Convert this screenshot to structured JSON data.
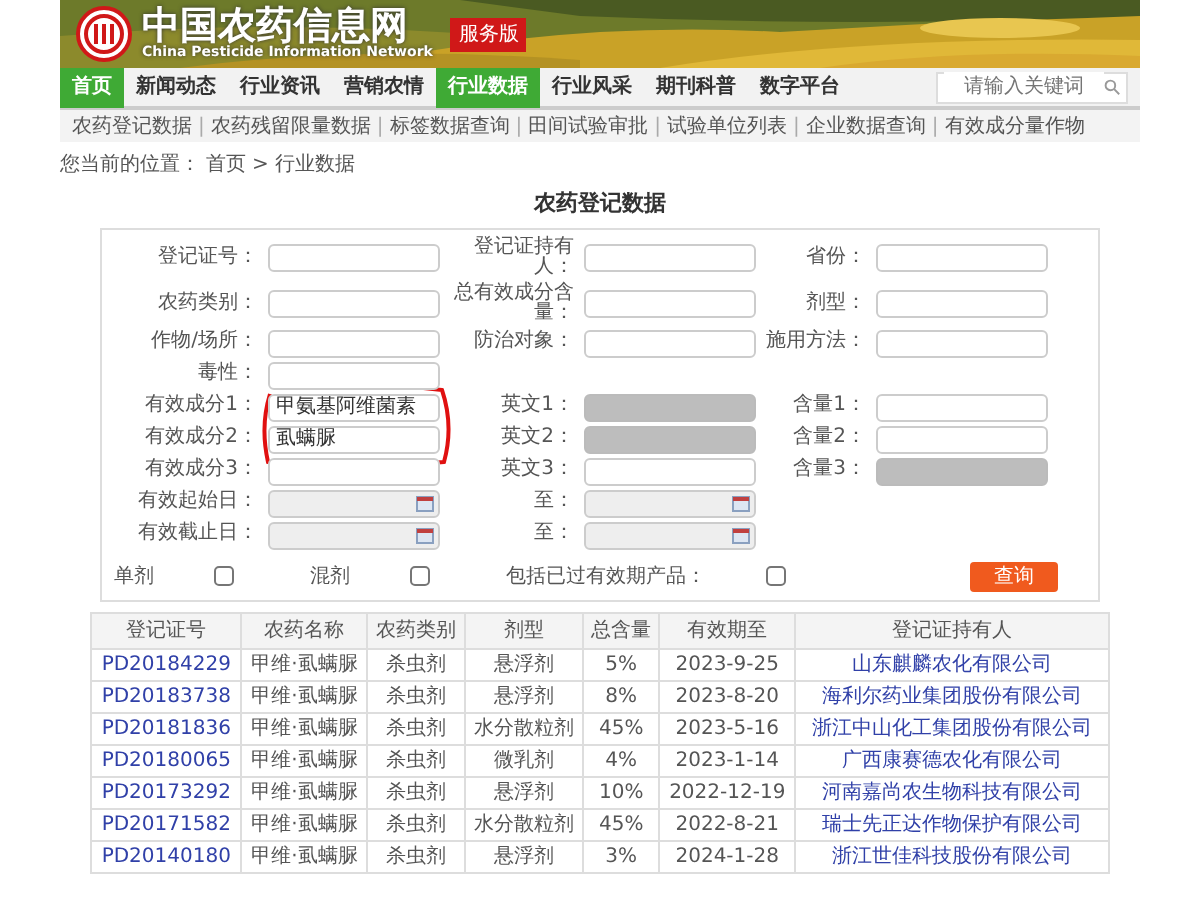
{
  "banner": {
    "title": "中国农药信息网",
    "subtitle": "China Pesticide Information Network",
    "badge": "服务版"
  },
  "nav": {
    "items": [
      {
        "label": "首页",
        "selected": true
      },
      {
        "label": "新闻动态",
        "selected": false
      },
      {
        "label": "行业资讯",
        "selected": false
      },
      {
        "label": "营销农情",
        "selected": false
      },
      {
        "label": "行业数据",
        "selected": true
      },
      {
        "label": "行业风采",
        "selected": false
      },
      {
        "label": "期刊科普",
        "selected": false
      },
      {
        "label": "数字平台",
        "selected": false
      }
    ],
    "search": {
      "placeholder": "请输入关键词"
    }
  },
  "subnav": {
    "items": [
      "农药登记数据",
      "农药残留限量数据",
      "标签数据查询",
      "田间试验审批",
      "试验单位列表",
      "企业数据查询",
      "有效成分量作物"
    ],
    "separator": "|"
  },
  "breadcrumb": {
    "prefix": "您当前的位置：",
    "items": [
      "首页",
      "行业数据"
    ],
    "separator": ">"
  },
  "page_title": "农药登记数据",
  "form": {
    "rows": [
      [
        {
          "label": "登记证号：",
          "kind": "text",
          "disabled": false
        },
        {
          "label": "登记证持有人：",
          "kind": "text",
          "disabled": false
        },
        {
          "label": "省份：",
          "kind": "text",
          "disabled": false
        }
      ],
      [
        {
          "label": "农药类别：",
          "kind": "text",
          "disabled": false
        },
        {
          "label": "总有效成分含量：",
          "kind": "text",
          "disabled": false
        },
        {
          "label": "剂型：",
          "kind": "text",
          "disabled": false
        }
      ],
      [
        {
          "label": "作物/场所：",
          "kind": "text",
          "disabled": false
        },
        {
          "label": "防治对象：",
          "kind": "text",
          "disabled": false
        },
        {
          "label": "施用方法：",
          "kind": "text",
          "disabled": false
        }
      ],
      [
        {
          "label": "毒性：",
          "kind": "text",
          "disabled": false
        }
      ],
      [
        {
          "label": "有效成分1：",
          "kind": "text",
          "value": "甲氨基阿维菌素",
          "disabled": false
        },
        {
          "label": "英文1：",
          "kind": "text",
          "disabled": true
        },
        {
          "label": "含量1：",
          "kind": "text",
          "disabled": false
        }
      ],
      [
        {
          "label": "有效成分2：",
          "kind": "text",
          "value": "虱螨脲",
          "disabled": false
        },
        {
          "label": "英文2：",
          "kind": "text",
          "disabled": true
        },
        {
          "label": "含量2：",
          "kind": "text",
          "disabled": false
        }
      ],
      [
        {
          "label": "有效成分3：",
          "kind": "text",
          "disabled": false
        },
        {
          "label": "英文3：",
          "kind": "text",
          "disabled": false
        },
        {
          "label": "含量3：",
          "kind": "text",
          "disabled": true
        }
      ],
      [
        {
          "label": "有效起始日：",
          "kind": "date",
          "disabled": true
        },
        {
          "label": "至：",
          "kind": "date",
          "disabled": true
        }
      ],
      [
        {
          "label": "有效截止日：",
          "kind": "date",
          "disabled": true
        },
        {
          "label": "至：",
          "kind": "date",
          "disabled": true
        }
      ]
    ],
    "checkboxes": [
      {
        "label": "单剂",
        "checked": false
      },
      {
        "label": "混剂",
        "checked": false
      },
      {
        "label": "包括已过有效期产品：",
        "checked": false
      }
    ],
    "button": "查询"
  },
  "table": {
    "columns": [
      "登记证号",
      "农药名称",
      "农药类别",
      "剂型",
      "总含量",
      "有效期至",
      "登记证持有人"
    ],
    "rows": [
      [
        "PD20184229",
        "甲维·虱螨脲",
        "杀虫剂",
        "悬浮剂",
        "5%",
        "2023-9-25",
        "山东麒麟农化有限公司"
      ],
      [
        "PD20183738",
        "甲维·虱螨脲",
        "杀虫剂",
        "悬浮剂",
        "8%",
        "2023-8-20",
        "海利尔药业集团股份有限公司"
      ],
      [
        "PD20181836",
        "甲维·虱螨脲",
        "杀虫剂",
        "水分散粒剂",
        "45%",
        "2023-5-16",
        "浙江中山化工集团股份有限公司"
      ],
      [
        "PD20180065",
        "甲维·虱螨脲",
        "杀虫剂",
        "微乳剂",
        "4%",
        "2023-1-14",
        "广西康赛德农化有限公司"
      ],
      [
        "PD20173292",
        "甲维·虱螨脲",
        "杀虫剂",
        "悬浮剂",
        "10%",
        "2022-12-19",
        "河南嘉尚农生物科技有限公司"
      ],
      [
        "PD20171582",
        "甲维·虱螨脲",
        "杀虫剂",
        "水分散粒剂",
        "45%",
        "2022-8-21",
        "瑞士先正达作物保护有限公司"
      ],
      [
        "PD20140180",
        "甲维·虱螨脲",
        "杀虫剂",
        "悬浮剂",
        "3%",
        "2024-1-28",
        "浙江世佳科技股份有限公司"
      ]
    ]
  }
}
